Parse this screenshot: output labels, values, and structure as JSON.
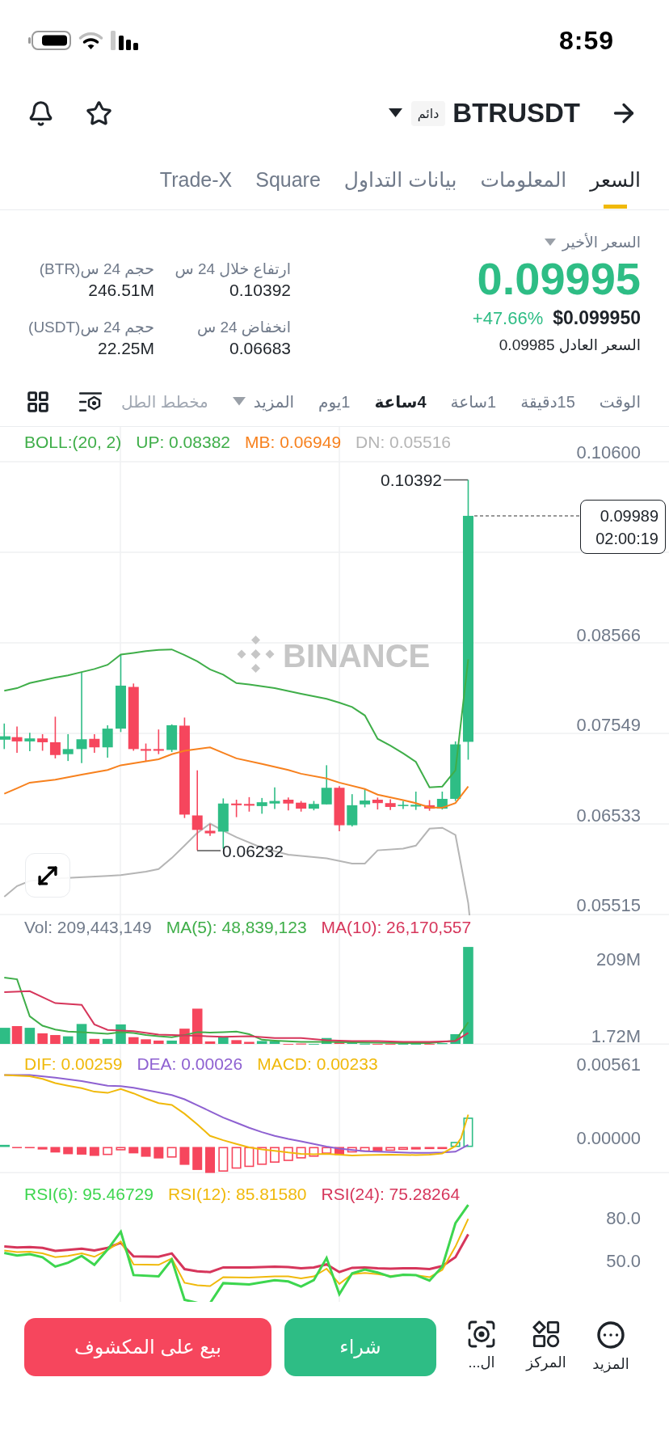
{
  "status_bar": {
    "time": "8:59"
  },
  "header": {
    "symbol": "BTRUSDT",
    "badge": "دائم"
  },
  "tabs": [
    {
      "label": "السعر",
      "selected": true
    },
    {
      "label": "المعلومات",
      "selected": false
    },
    {
      "label": "بيانات التداول",
      "selected": false
    },
    {
      "label": "Square",
      "selected": false
    },
    {
      "label": "Trade-X",
      "selected": false
    }
  ],
  "price": {
    "label": "السعر الأخير",
    "last": "0.09995",
    "change": "+47.66%",
    "usd": "$0.099950",
    "fair": "السعر العادل 0.09985"
  },
  "stats": [
    {
      "label": "ارتفاع خلال 24 س",
      "value": "0.10392"
    },
    {
      "label": "حجم 24 س(BTR)",
      "value": "246.51M"
    },
    {
      "label": "انخفاض 24 س",
      "value": "0.06683"
    },
    {
      "label": "حجم 24 س(USDT)",
      "value": "22.25M"
    }
  ],
  "toolbar": {
    "time_label": "الوقت",
    "intervals": [
      {
        "label": "15دقيقة",
        "selected": false
      },
      {
        "label": "1ساعة",
        "selected": false
      },
      {
        "label": "4ساعة",
        "selected": true
      },
      {
        "label": "1يوم",
        "selected": false
      }
    ],
    "more": "المزيد",
    "chart_tab": "مخطط الطل"
  },
  "main_chart": {
    "legend": [
      {
        "text": "DN: 0.05516",
        "color": "#b5b5b5"
      },
      {
        "text": "MB: 0.06949",
        "color": "#f7811e"
      },
      {
        "text": "UP: 0.08382",
        "color": "#3fae49"
      },
      {
        "text": "BOLL:(20, 2)",
        "color": "#3fae49"
      }
    ],
    "axis_labels": [
      "0.10600",
      "0.08566",
      "0.07549",
      "0.06533",
      "0.05515"
    ],
    "high_label": "0.10392",
    "low_label": "0.06232",
    "price_tag": {
      "price": "0.09989",
      "countdown": "02:00:19"
    },
    "watermark": "BINANCE"
  },
  "volume": {
    "legend": [
      {
        "text": "MA(10): 26,170,557",
        "color": "#d6365b"
      },
      {
        "text": "MA(5): 48,839,123",
        "color": "#3fae49"
      },
      {
        "text": "Vol: 209,443,149",
        "color": "#707a8a"
      }
    ],
    "axis_labels": [
      "209M",
      "1.72M"
    ]
  },
  "macd": {
    "legend": [
      {
        "text": "MACD: 0.00233",
        "color": "#f0b90b"
      },
      {
        "text": "DEA: 0.00026",
        "color": "#8e61d1"
      },
      {
        "text": "DIF: 0.00259",
        "color": "#f0b90b"
      }
    ],
    "axis_labels": [
      "0.00561",
      "0.00000"
    ]
  },
  "rsi": {
    "legend": [
      {
        "text": "RSI(24): 75.28264",
        "color": "#d6365b"
      },
      {
        "text": "RSI(12): 85.81580",
        "color": "#f0b90b"
      },
      {
        "text": "RSI(6): 95.46729",
        "color": "#3dd64f"
      }
    ],
    "axis_labels": [
      "80.0",
      "50.0"
    ]
  },
  "actions": {
    "sell": "بيع على المكشوف",
    "buy": "شراء",
    "items": [
      {
        "label": "المزيد"
      },
      {
        "label": "المركز"
      },
      {
        "label": "ال..."
      }
    ]
  }
}
